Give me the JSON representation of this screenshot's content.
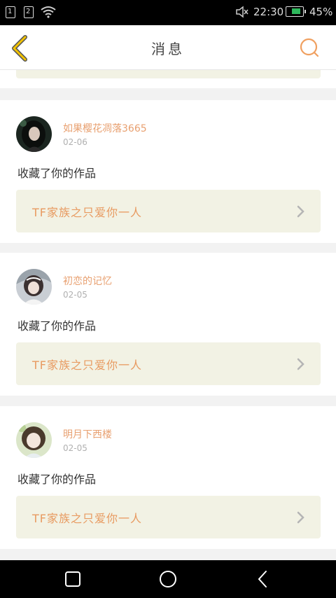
{
  "status_bar": {
    "sim1": "1",
    "sim2": "2",
    "time": "22:30",
    "battery": "45%",
    "battery_level": 0.45
  },
  "header": {
    "title": "消息"
  },
  "messages": [
    {
      "user": "如果樱花凋落3665",
      "date": "02-06",
      "action": "收藏了你的作品",
      "work": "TF家族之只爱你一人"
    },
    {
      "user": "初恋的记忆",
      "date": "02-05",
      "action": "收藏了你的作品",
      "work": "TF家族之只爱你一人"
    },
    {
      "user": "明月下西楼",
      "date": "02-05",
      "action": "收藏了你的作品",
      "work": "TF家族之只爱你一人"
    }
  ],
  "colors": {
    "accent": "#e8a070",
    "back_arrow": "#f2c200",
    "card_bg": "#f2f2e4"
  },
  "icons": {
    "back": "chevron-left-icon",
    "search": "search-icon",
    "recents": "square-icon",
    "home": "circle-icon",
    "nav_back": "back-triangle-icon"
  }
}
